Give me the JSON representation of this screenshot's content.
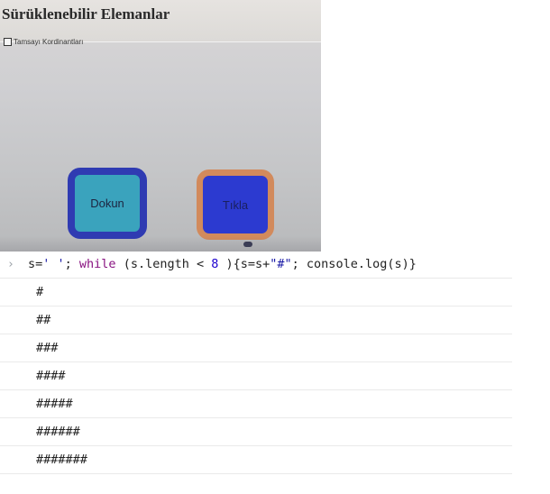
{
  "page": {
    "title": "Sürüklenebilir Elemanlar",
    "checkbox_label": "Tamsayı Kordinantları",
    "buttons": {
      "dokun": "Dokun",
      "tikla": "Tıkla"
    }
  },
  "console": {
    "prompt_icon": "chevron-right-icon",
    "code_tokens": [
      {
        "t": "s=",
        "k": "plain"
      },
      {
        "t": "' '",
        "k": "str"
      },
      {
        "t": "; ",
        "k": "plain"
      },
      {
        "t": "while",
        "k": "kw"
      },
      {
        "t": " (s.length < ",
        "k": "plain"
      },
      {
        "t": "8",
        "k": "num"
      },
      {
        "t": " ){s=s+",
        "k": "plain"
      },
      {
        "t": "\"#\"",
        "k": "str"
      },
      {
        "t": "; console.log(s)}",
        "k": "plain"
      }
    ],
    "output": [
      "#",
      "##",
      "###",
      "####",
      "#####",
      "######",
      "#######"
    ]
  }
}
